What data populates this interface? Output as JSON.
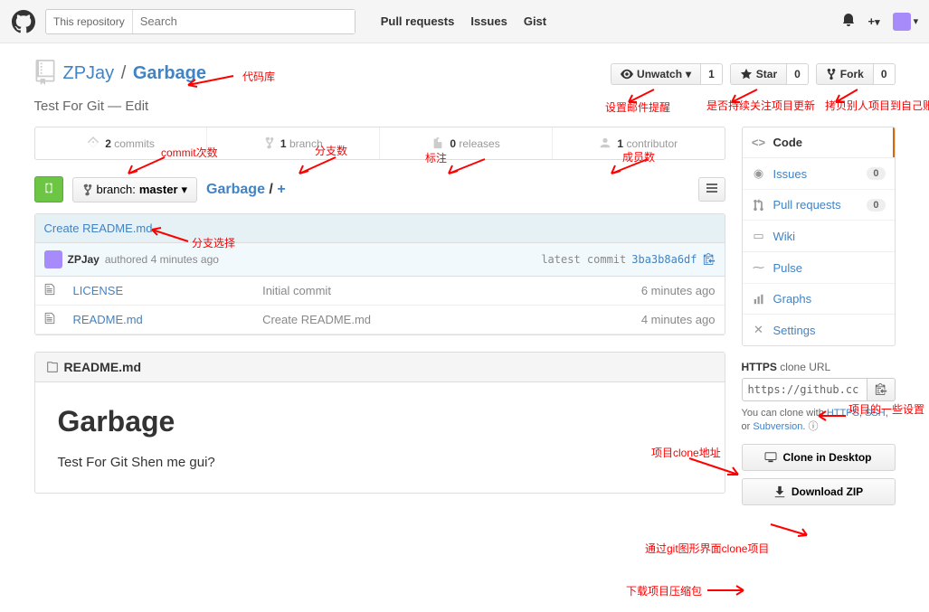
{
  "topbar": {
    "search_scope": "This repository",
    "search_placeholder": "Search",
    "nav": {
      "pulls": "Pull requests",
      "issues": "Issues",
      "gist": "Gist"
    }
  },
  "repo": {
    "owner": "ZPJay",
    "name": "Garbage",
    "description": "Test For Git — Edit"
  },
  "actions": {
    "watch": {
      "label": "Unwatch",
      "count": "1"
    },
    "star": {
      "label": "Star",
      "count": "0"
    },
    "fork": {
      "label": "Fork",
      "count": "0"
    }
  },
  "stats": {
    "commits": {
      "n": "2",
      "label": "commits"
    },
    "branches": {
      "n": "1",
      "label": "branch"
    },
    "releases": {
      "n": "0",
      "label": "releases"
    },
    "contributors": {
      "n": "1",
      "label": "contributor"
    }
  },
  "branch": {
    "prefix": "branch:",
    "name": "master"
  },
  "path": {
    "root": "Garbage",
    "sep": "/",
    "plus": "+"
  },
  "commit": {
    "message": "Create README.md",
    "author": "ZPJay",
    "authored": "authored 4 minutes ago",
    "latest_label": "latest commit",
    "sha": "3ba3b8a6df"
  },
  "files": [
    {
      "name": "LICENSE",
      "msg": "Initial commit",
      "time": "6 minutes ago"
    },
    {
      "name": "README.md",
      "msg": "Create README.md",
      "time": "4 minutes ago"
    }
  ],
  "readme": {
    "filename": "README.md",
    "title": "Garbage",
    "body": "Test For Git Shen me gui?"
  },
  "sidenav": {
    "code": "Code",
    "issues": {
      "label": "Issues",
      "count": "0"
    },
    "pulls": {
      "label": "Pull requests",
      "count": "0"
    },
    "wiki": "Wiki",
    "pulse": "Pulse",
    "graphs": "Graphs",
    "settings": "Settings"
  },
  "clone": {
    "proto": "HTTPS",
    "label": "clone URL",
    "url": "https://github.cc",
    "help_pre": "You can clone with ",
    "https": "HTTPS",
    "c1": ", ",
    "ssh": "SSH",
    "c2": ", or ",
    "svn": "Subversion",
    "c3": ". "
  },
  "buttons": {
    "desktop": "Clone in Desktop",
    "zip": "Download ZIP"
  },
  "annotations": {
    "a1": "代码库",
    "a2": "commit次数",
    "a3": "分支数",
    "a4": "标注",
    "a5": "成员数",
    "a6": "设置邮件提醒",
    "a7": "是否持续关注项目更新",
    "a8": "拷贝别人项目到自己账号",
    "a9": "分支选择",
    "a10": "项目的一些设置",
    "a11": "项目clone地址",
    "a12": "通过git图形界面clone项目",
    "a13": "下载项目压缩包"
  }
}
